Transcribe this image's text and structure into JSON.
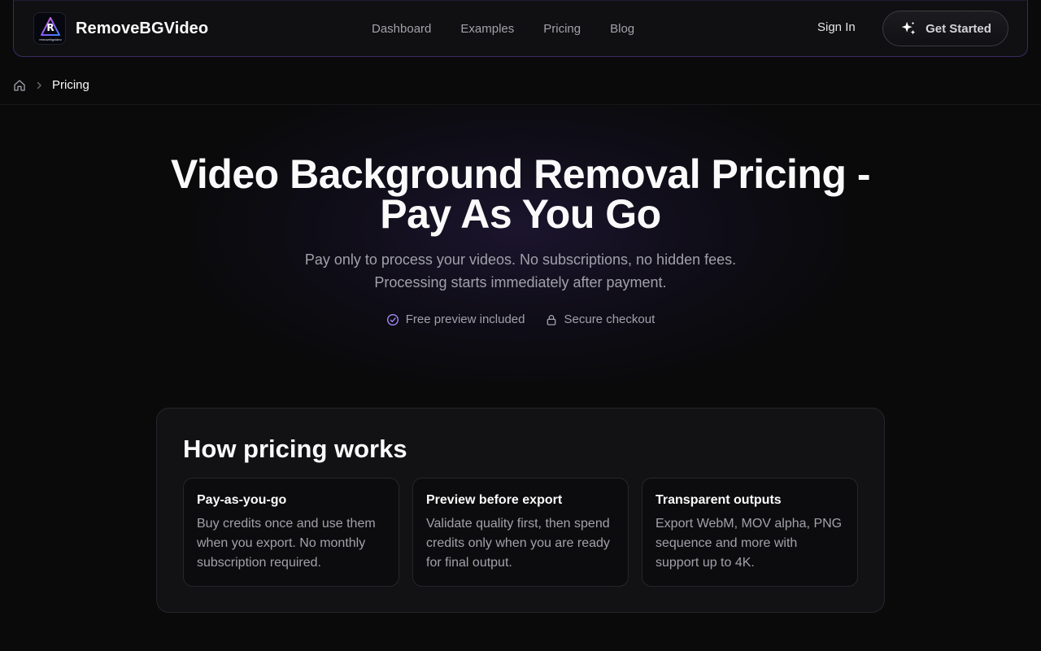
{
  "header": {
    "brand_name": "RemoveBGVideo",
    "logo_text": "removebgvideo",
    "nav": [
      "Dashboard",
      "Examples",
      "Pricing",
      "Blog"
    ],
    "sign_in": "Sign In",
    "cta": "Get Started"
  },
  "breadcrumb": {
    "current": "Pricing"
  },
  "hero": {
    "title_line1": "Video Background Removal Pricing -",
    "title_line2": "Pay As You Go",
    "subtitle_line1": "Pay only to process your videos. No subscriptions, no hidden fees.",
    "subtitle_line2": "Processing starts immediately after payment.",
    "badges": [
      "Free preview included",
      "Secure checkout"
    ]
  },
  "pricing": {
    "title": "How pricing works",
    "features": [
      {
        "title": "Pay-as-you-go",
        "text": "Buy credits once and use them when you export. No monthly subscription required."
      },
      {
        "title": "Preview before export",
        "text": "Validate quality first, then spend credits only when you are ready for final output."
      },
      {
        "title": "Transparent outputs",
        "text": "Export WebM, MOV alpha, PNG sequence and more with support up to 4K."
      }
    ]
  },
  "colors": {
    "background": "#0a0a0b",
    "accent": "#8b5cf6",
    "muted_text": "#a1a1aa"
  }
}
